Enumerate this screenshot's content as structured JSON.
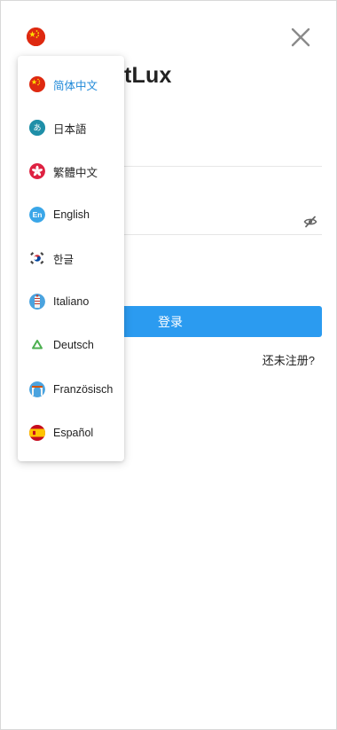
{
  "app": {
    "title_visible": "tLux"
  },
  "form": {
    "login_label": "登录",
    "register_label": "还未注册?"
  },
  "language_menu": {
    "selected": "简体中文",
    "items": [
      {
        "label": "简体中文",
        "icon": "china-flag-icon",
        "active": true
      },
      {
        "label": "日本語",
        "icon": "japanese-hiragana-icon",
        "active": false
      },
      {
        "label": "繁體中文",
        "icon": "hong-kong-flag-icon",
        "active": false
      },
      {
        "label": "English",
        "icon": "english-en-icon",
        "active": false
      },
      {
        "label": "한글",
        "icon": "korea-flag-icon",
        "active": false
      },
      {
        "label": "Italiano",
        "icon": "italy-landmark-icon",
        "active": false
      },
      {
        "label": "Deutsch",
        "icon": "germany-recycle-icon",
        "active": false
      },
      {
        "label": "Französisch",
        "icon": "france-landmark-icon",
        "active": false
      },
      {
        "label": "Español",
        "icon": "spain-flag-icon",
        "active": false
      }
    ]
  },
  "colors": {
    "primary": "#2b9bf0",
    "active_text": "#1e88d8",
    "china_red": "#de2910"
  }
}
